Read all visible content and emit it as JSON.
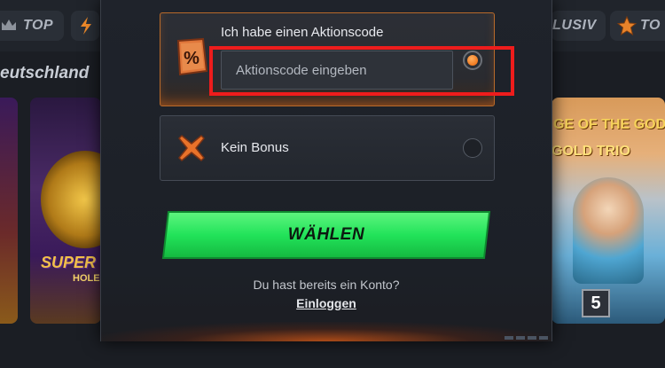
{
  "nav": {
    "top_label": "TOP",
    "exclusive_partial": "LUSIV",
    "top2_label": "TO"
  },
  "section": {
    "title": "eutschland"
  },
  "games": {
    "left_title": "SUPER",
    "left_sub": "HOLE",
    "right_title": "GE OF THE GODS",
    "right_sub": "GOLD TRIO",
    "right_number": "5"
  },
  "modal": {
    "promo_option": {
      "title": "Ich habe einen Aktionscode",
      "input_placeholder": "Aktionscode eingeben",
      "input_value": "",
      "icon": "percent-tag-icon",
      "selected": true
    },
    "no_bonus_option": {
      "title": "Kein Bonus",
      "icon": "x-mark-icon",
      "selected": false
    },
    "select_button": "WÄHLEN",
    "account_hint": "Du hast bereits ein Konto?",
    "login_link": "Einloggen"
  },
  "colors": {
    "accent_orange": "#f07a20",
    "button_green": "#22e35a",
    "highlight_red": "#ee1c1c",
    "background": "#1b1e24"
  }
}
